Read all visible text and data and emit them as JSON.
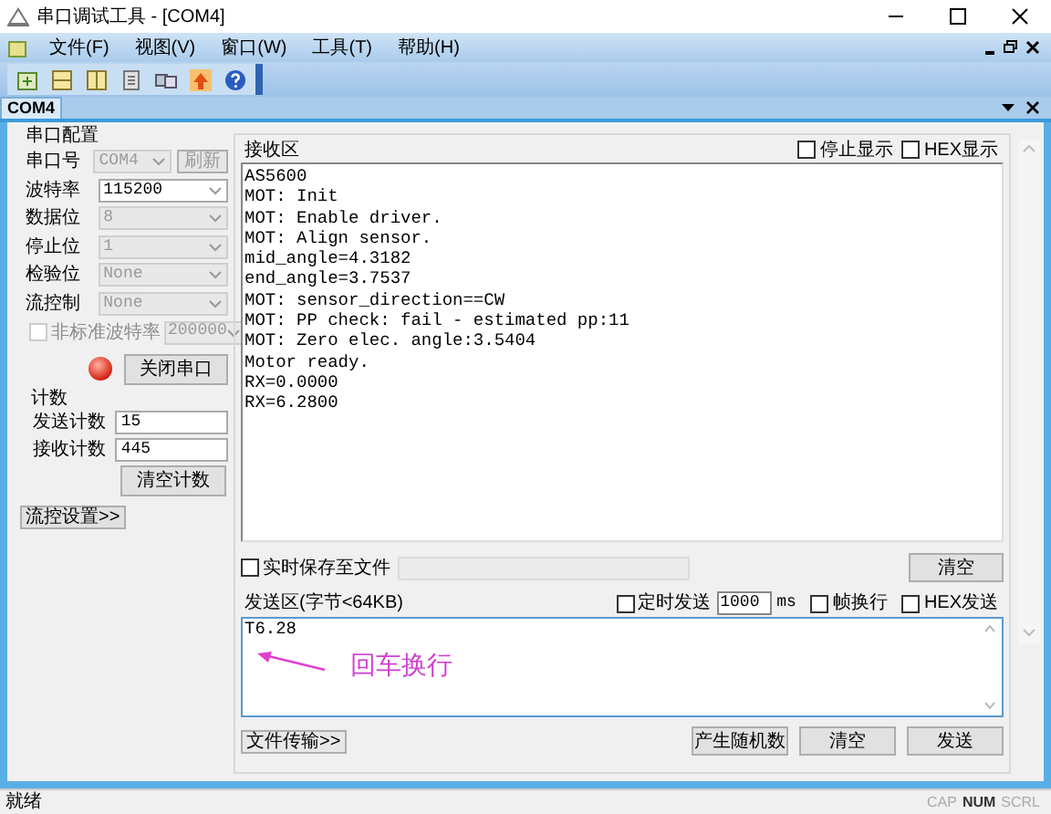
{
  "window": {
    "title": "串口调试工具 - [COM4]"
  },
  "menu": [
    "文件(F)",
    "视图(V)",
    "窗口(W)",
    "工具(T)",
    "帮助(H)"
  ],
  "tabs": [
    {
      "label": "COM4",
      "selected": true
    }
  ],
  "serial_config": {
    "title": "串口配置",
    "fields": [
      {
        "label": "串口号",
        "value": "COM4",
        "disabled": true
      },
      {
        "label": "波特率",
        "value": "115200",
        "disabled": false
      },
      {
        "label": "数据位",
        "value": "8",
        "disabled": true
      },
      {
        "label": "停止位",
        "value": "1",
        "disabled": true
      },
      {
        "label": "检验位",
        "value": "None",
        "disabled": true
      },
      {
        "label": "流控制",
        "value": "None",
        "disabled": true
      }
    ],
    "refresh_button": {
      "label": "刷新",
      "disabled": true
    },
    "nonstandard_baud": {
      "label": "非标准波特率",
      "checked": false,
      "value": "200000",
      "disabled": true
    },
    "led": {
      "on": true
    },
    "port_button": "关闭串口"
  },
  "counters": {
    "title": "计数",
    "rows": [
      {
        "label": "发送计数",
        "value": "15"
      },
      {
        "label": "接收计数",
        "value": "445"
      }
    ],
    "clear_button": "清空计数"
  },
  "flow_button": "流控设置>>",
  "receive": {
    "title": "接收区",
    "stop_display": {
      "label": "停止显示",
      "checked": false
    },
    "hex_display": {
      "label": "HEX显示",
      "checked": false
    },
    "lines": [
      "AS5600",
      "MOT: Init",
      "MOT: Enable driver.",
      "MOT: Align sensor.",
      "mid_angle=4.3182",
      "end_angle=3.7537",
      "MOT: sensor_direction==CW",
      "MOT: PP check: fail - estimated pp:11",
      "MOT: Zero elec. angle:3.5404",
      "Motor ready.",
      "RX=0.0000",
      "RX=6.2800"
    ]
  },
  "save_to_file": {
    "label": "实时保存至文件",
    "checked": false,
    "clear_button": "清空"
  },
  "send": {
    "title": "发送区(字节<64KB)",
    "timed_send": {
      "label": "定时发送",
      "checked": false
    },
    "interval": "1000",
    "unit": "ms",
    "frame_newline": {
      "label": "帧换行",
      "checked": false
    },
    "hex_send": {
      "label": "HEX发送",
      "checked": false
    },
    "text": "T6.28",
    "annotation": "回车换行",
    "file_button": "文件传输>>",
    "random_button": "产生随机数",
    "clear_button": "清空",
    "send_button": "发送"
  },
  "status_bar": {
    "text": "就绪",
    "indicators": [
      {
        "label": "CAP",
        "active": false
      },
      {
        "label": "NUM",
        "active": true
      },
      {
        "label": "SCRL",
        "active": false
      }
    ]
  }
}
